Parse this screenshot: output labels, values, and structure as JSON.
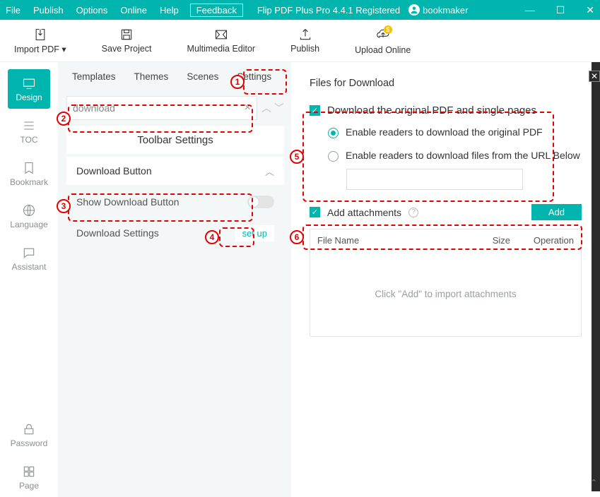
{
  "menubar": {
    "file": "File",
    "publish": "Publish",
    "options": "Options",
    "online": "Online",
    "help": "Help",
    "feedback": "Feedback",
    "app_title": "Flip PDF Plus Pro 4.4.1 Registered",
    "username": "bookmaker"
  },
  "wincontrols": {
    "min": "—",
    "max": "☐",
    "close": "✕"
  },
  "toolbar": {
    "import": "Import PDF ▾",
    "save": "Save Project",
    "multimedia": "Multimedia Editor",
    "publish": "Publish",
    "upload": "Upload Online"
  },
  "sidenav": {
    "design": "Design",
    "toc": "TOC",
    "bookmark": "Bookmark",
    "language": "Language",
    "assistant": "Assistant",
    "password": "Password",
    "page": "Page"
  },
  "tabs": {
    "templates": "Templates",
    "themes": "Themes",
    "scenes": "Scenes",
    "settings": "Settings"
  },
  "search": {
    "value": "download"
  },
  "sections": {
    "toolbar_settings": "Toolbar Settings",
    "download_button": "Download Button",
    "show_download_button": "Show Download Button",
    "download_settings": "Download Settings",
    "setup": "set up"
  },
  "right": {
    "title": "Files for Download",
    "dl_original_and_single": "Download the original PDF and single pages",
    "radio_original": "Enable readers to download the original PDF",
    "radio_url": "Enable readers to download files from the URL Below",
    "add_attachments": "Add attachments",
    "add_btn": "Add",
    "th_filename": "File Name",
    "th_size": "Size",
    "th_operation": "Operation",
    "empty": "Click \"Add\" to import attachments"
  },
  "callouts": {
    "1": "1",
    "2": "2",
    "3": "3",
    "4": "4",
    "5": "5",
    "6": "6"
  }
}
